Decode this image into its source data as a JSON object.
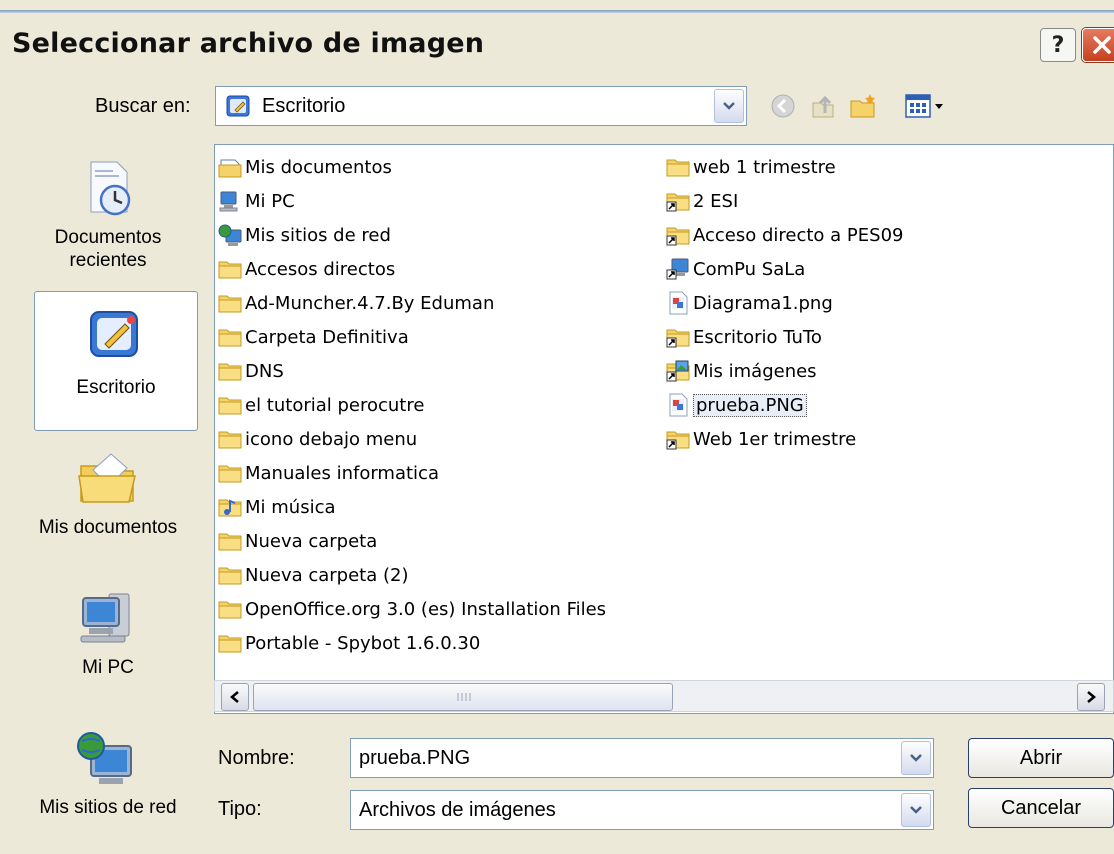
{
  "window": {
    "title": "Seleccionar archivo de imagen",
    "help": "?"
  },
  "lookin": {
    "label": "Buscar en:",
    "value": "Escritorio"
  },
  "places": [
    {
      "label": "Documentos recientes",
      "icon": "recent-documents-icon"
    },
    {
      "label": "Escritorio",
      "icon": "desktop-icon"
    },
    {
      "label": "Mis documentos",
      "icon": "my-documents-icon"
    },
    {
      "label": "Mi PC",
      "icon": "my-computer-icon"
    },
    {
      "label": "Mis sitios de red",
      "icon": "network-places-icon"
    }
  ],
  "files_col1": [
    {
      "name": "Mis documentos",
      "icon": "my-documents-icon"
    },
    {
      "name": "Mi PC",
      "icon": "my-computer-icon"
    },
    {
      "name": "Mis sitios de red",
      "icon": "network-places-icon"
    },
    {
      "name": "Accesos directos",
      "icon": "folder-icon"
    },
    {
      "name": "Ad-Muncher.4.7.By Eduman",
      "icon": "folder-icon"
    },
    {
      "name": "Carpeta Definitiva",
      "icon": "folder-icon"
    },
    {
      "name": "DNS",
      "icon": "folder-icon"
    },
    {
      "name": "el tutorial perocutre",
      "icon": "folder-icon"
    },
    {
      "name": "icono debajo menu",
      "icon": "folder-icon"
    },
    {
      "name": "Manuales informatica",
      "icon": "folder-icon"
    },
    {
      "name": "Mi música",
      "icon": "music-folder-icon"
    },
    {
      "name": "Nueva carpeta",
      "icon": "folder-icon"
    },
    {
      "name": "Nueva carpeta (2)",
      "icon": "folder-icon"
    },
    {
      "name": "OpenOffice.org 3.0 (es) Installation Files",
      "icon": "folder-icon"
    },
    {
      "name": "Portable - Spybot 1.6.0.30",
      "icon": "folder-icon"
    }
  ],
  "files_col2": [
    {
      "name": "web 1 trimestre",
      "icon": "folder-icon"
    },
    {
      "name": "2 ESI",
      "icon": "folder-shortcut-icon"
    },
    {
      "name": "Acceso directo a PES09",
      "icon": "folder-shortcut-icon"
    },
    {
      "name": "ComPu SaLa",
      "icon": "computer-shortcut-icon"
    },
    {
      "name": "Diagrama1.png",
      "icon": "png-file-icon"
    },
    {
      "name": "Escritorio TuTo",
      "icon": "folder-shortcut-icon"
    },
    {
      "name": "Mis imágenes",
      "icon": "pictures-shortcut-icon"
    },
    {
      "name": "prueba.PNG",
      "icon": "png-file-icon",
      "selected": true
    },
    {
      "name": "Web 1er trimestre",
      "icon": "folder-shortcut-icon"
    }
  ],
  "filename": {
    "label": "Nombre:",
    "value": "prueba.PNG"
  },
  "filetype": {
    "label": "Tipo:",
    "value": "Archivos de imágenes"
  },
  "buttons": {
    "open": "Abrir",
    "cancel": "Cancelar"
  }
}
